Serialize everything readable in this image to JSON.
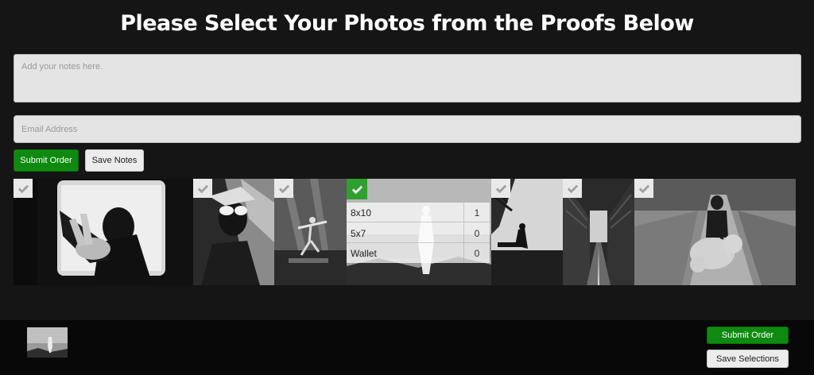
{
  "page": {
    "title": "Please Select Your Photos from the Proofs Below"
  },
  "form": {
    "notes_placeholder": "Add your notes here.",
    "email_placeholder": "Email Address",
    "submit_label": "Submit Order",
    "save_notes_label": "Save Notes"
  },
  "photos": [
    {
      "selected": false,
      "subject": "hand reaching toward camera"
    },
    {
      "selected": false,
      "subject": "woman with white sunglasses"
    },
    {
      "selected": false,
      "subject": "dancer in studio"
    },
    {
      "selected": true,
      "subject": "statue by the sea"
    },
    {
      "selected": false,
      "subject": "man on bench"
    },
    {
      "selected": false,
      "subject": "person between buildings"
    },
    {
      "selected": false,
      "subject": "girl with teddy bear on road"
    }
  ],
  "size_options": [
    {
      "label": "8x10",
      "qty": "1"
    },
    {
      "label": "5x7",
      "qty": "0"
    },
    {
      "label": "Wallet",
      "qty": "0"
    }
  ],
  "footer": {
    "submit_label": "Submit Order",
    "save_selections_label": "Save Selections"
  },
  "colors": {
    "accent_green": "#0f8a10",
    "check_green": "#2fa02f",
    "background": "#151515"
  }
}
